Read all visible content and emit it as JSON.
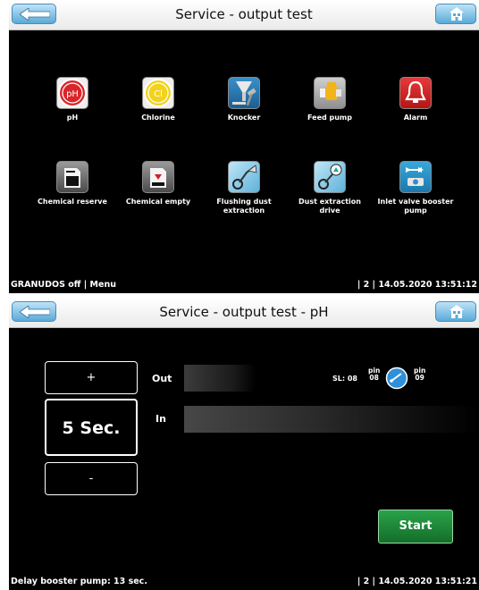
{
  "screen1": {
    "title": "Service - output test",
    "tiles": [
      {
        "label": "pH"
      },
      {
        "label": "Chlorine"
      },
      {
        "label": "Knocker"
      },
      {
        "label": "Feed pump"
      },
      {
        "label": "Alarm"
      },
      {
        "label": "Chemical reserve"
      },
      {
        "label": "Chemical empty"
      },
      {
        "label": "Flushing dust extraction"
      },
      {
        "label": "Dust extraction drive"
      },
      {
        "label": "Inlet valve booster pump"
      }
    ],
    "status_left": "GRANUDOS off | Menu",
    "status_right": "| 2 | 14.05.2020 13:51:12"
  },
  "screen2": {
    "title": "Service - output test - pH",
    "plus_label": "+",
    "minus_label": "-",
    "duration": "5 Sec.",
    "out_label": "Out",
    "in_label": "In",
    "sl_label": "SL: 08",
    "pin_left": "pin\n08",
    "pin_right": "pin\n09",
    "start_label": "Start",
    "status_left": "Delay booster pump: 13 sec.",
    "status_right": "| 2 | 14.05.2020 13:51:21"
  },
  "icons": {
    "tiles": [
      "ph-icon",
      "chlorine-icon",
      "knocker-icon",
      "feed-pump-icon",
      "alarm-icon",
      "chemical-reserve-icon",
      "chemical-empty-icon",
      "flushing-dust-extraction-icon",
      "dust-extraction-drive-icon",
      "inlet-valve-booster-pump-icon"
    ]
  },
  "colors": {
    "titlebar_button": "#5aaad8",
    "start_button": "#1e8a3a",
    "ph_red": "#d9262a",
    "chlorine_yellow": "#f2d21c",
    "alarm_red": "#d72626"
  }
}
